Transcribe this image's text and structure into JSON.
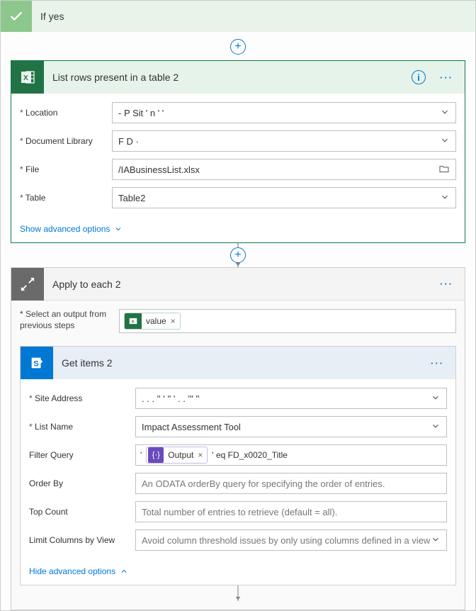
{
  "condition": {
    "title": "If yes"
  },
  "excel_card": {
    "title": "List rows present in a table 2",
    "fields": {
      "location": {
        "label": "Location",
        "value": "   -  P       Sit     '  n   ' '"
      },
      "doc_lib": {
        "label": "Document Library",
        "value": "F            D    ·"
      },
      "file": {
        "label": "File",
        "value": "/IABusinessList.xlsx"
      },
      "table": {
        "label": "Table",
        "value": "Table2"
      }
    },
    "advanced": "Show advanced options"
  },
  "apply": {
    "title": "Apply to each 2",
    "select_label": "Select an output from previous steps",
    "token": "value"
  },
  "sp_card": {
    "title": "Get items 2",
    "fields": {
      "site": {
        "label": "Site Address",
        "value": "   . .  . '' '      ''        '  .           .            '''      ''"
      },
      "list": {
        "label": "List Name",
        "value": "Impact Assessment Tool"
      },
      "filter": {
        "label": "Filter Query",
        "pre": "'",
        "token": "Output",
        "post": "' eq FD_x0020_Title"
      },
      "orderby": {
        "label": "Order By",
        "placeholder": "An ODATA orderBy query for specifying the order of entries."
      },
      "top": {
        "label": "Top Count",
        "placeholder": "Total number of entries to retrieve (default = all)."
      },
      "limit": {
        "label": "Limit Columns by View",
        "placeholder": "Avoid column threshold issues by only using columns defined in a view"
      }
    },
    "advanced": "Hide advanced options"
  }
}
